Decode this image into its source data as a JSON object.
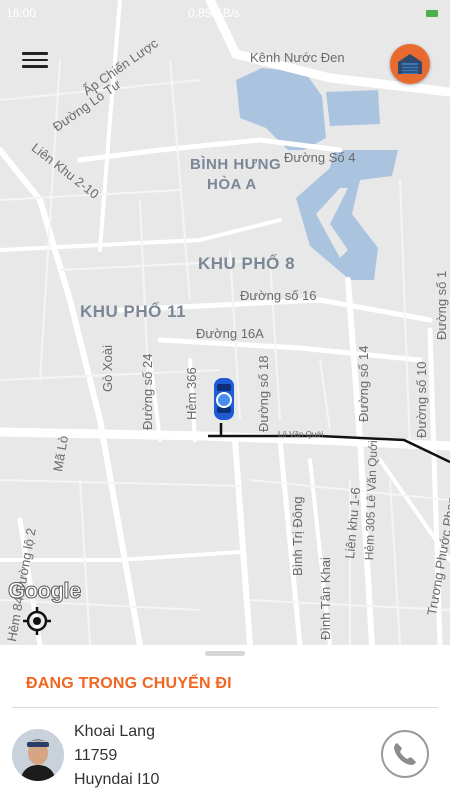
{
  "status_bar": {
    "time": "16:00",
    "speed": "0,85 KB/s",
    "battery_color": "#4caf50"
  },
  "map": {
    "districts": [
      "BÌNH HƯNG",
      "HÒA A",
      "KHU PHỐ 8",
      "KHU PHỐ 11"
    ],
    "streets": {
      "kenh_nuoc_den": "Kênh Nước Đen",
      "ap_chien_luoc": "Ấp Chiến Lược",
      "duong_lo_tu": "Đường Lò Tư",
      "lien_khu_2_10": "Liên Khu 2-10",
      "duong_so_4": "Đường Số 4",
      "duong_so_16": "Đường số 16",
      "duong_16a": "Đường 16A",
      "go_xoai": "Gò Xoài",
      "duong_so_24": "Đường số 24",
      "hem_366": "Hẻm 366",
      "duong_so_18": "Đường số 18",
      "le_van_quoi": "Lê Văn Quới",
      "ma_lo": "Mã Lò",
      "duong_so_14": "Đường số 14",
      "duong_so_10": "Đường số 10",
      "duong_so_1": "Đường số 1",
      "lien_khu_1_6": "Liên khu 1-6",
      "hem_305": "Hẻm 305 Lê Văn Quới",
      "binh_tri_dong": "Bình Trị Đông",
      "truong_phuoc_phan": "Trương Phước Phan",
      "dinh_tan_khai": "Đình Tân Khai",
      "hem_84": "Hẻm 84 Đường lộ 2"
    },
    "google_logo": "Google",
    "route_color": "#111111",
    "car_color": "#1e5bd6"
  },
  "controls": {
    "menu_icon": "hamburger-menu-icon",
    "garage_icon": "garage-icon",
    "locate_icon": "my-location-icon",
    "accent_color": "#e86a2f"
  },
  "trip": {
    "status": "ĐANG TRONG CHUYẾN ĐI",
    "status_color": "#f26522",
    "driver": {
      "name": "Khoai Lang",
      "id": "11759",
      "vehicle": "Huyndai I10"
    },
    "call_icon": "phone-icon"
  }
}
